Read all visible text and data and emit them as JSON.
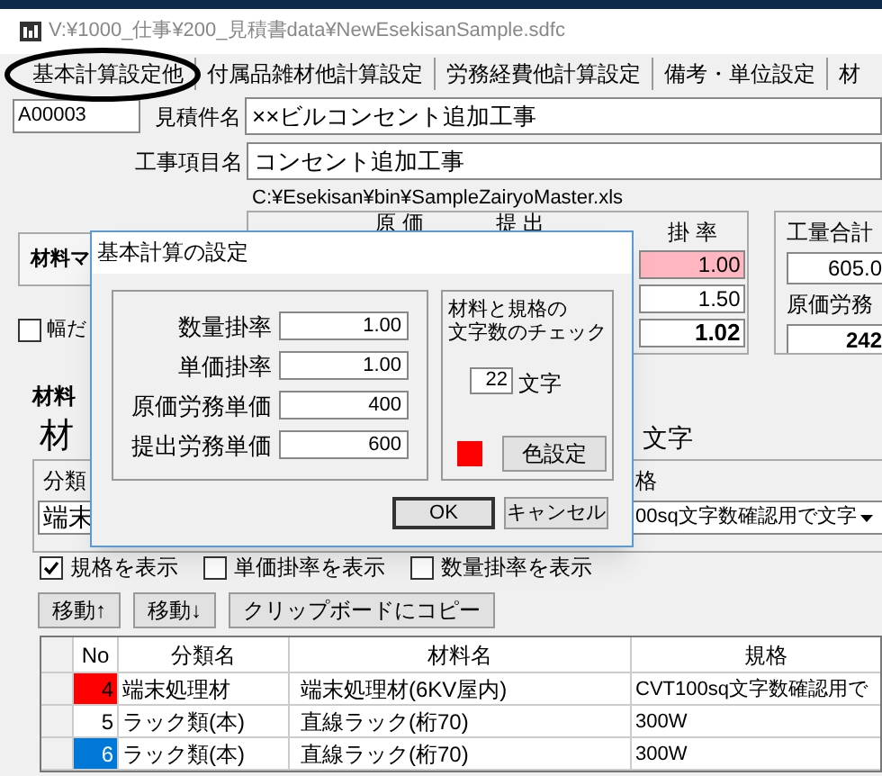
{
  "window": {
    "title": "V:¥1000_仕事¥200_見積書data¥NewEsekisanSample.sdfc"
  },
  "menu": [
    {
      "label": "基本計算設定他",
      "circled": true
    },
    {
      "label": "付属品雑材他計算設定",
      "circled": false
    },
    {
      "label": "労務経費他計算設定",
      "circled": false
    },
    {
      "label": "備考・単位設定",
      "circled": false
    },
    {
      "label": "材",
      "circled": false
    }
  ],
  "header": {
    "code": "A00003",
    "estimate_label": "見積件名",
    "estimate_name": "××ビルコンセント追加工事",
    "item_label": "工事項目名",
    "item_name": "コンセント追加工事",
    "master_path": "C:¥Esekisan¥bin¥SampleZairyoMaster.xls"
  },
  "panel_button": "材料マ",
  "width_check": {
    "label": "幅だ",
    "checked": false
  },
  "summary": {
    "columns": [
      "原 価",
      "提 出",
      "掛 率"
    ],
    "rates": [
      {
        "value": "1.00",
        "kind": "highlight"
      },
      {
        "value": "1.50",
        "kind": "plain"
      },
      {
        "value": "1.02",
        "kind": "total"
      }
    ]
  },
  "totals": {
    "label": "工量合計",
    "value": "605.0",
    "label_2": "原価労務",
    "value_2": "242"
  },
  "material_tab": "材料",
  "material_heading": "材",
  "chars_suffix": "文字",
  "group": {
    "label": "分類",
    "label_2": "格",
    "combo": "端末",
    "dropdown": "00sq文字数確認用で文字"
  },
  "options": [
    {
      "label": "規格を表示",
      "checked": true
    },
    {
      "label": "単価掛率を表示",
      "checked": false
    },
    {
      "label": "数量掛率を表示",
      "checked": false
    }
  ],
  "buttons": [
    "移動↑",
    "移動↓",
    "クリップボードにコピー"
  ],
  "table": {
    "columns": [
      "No",
      "分類名",
      "材料名",
      "規格"
    ],
    "rows": [
      {
        "no": "4",
        "color": "#ff0000",
        "category": "端末処理材",
        "name": "端末処理材(6KV屋内)",
        "spec": "CVT100sq文字数確認用で"
      },
      {
        "no": "5",
        "color": "#ffffff",
        "category": "ラック類(本)",
        "name": "直線ラック(桁70)",
        "spec": "300W"
      },
      {
        "no": "6",
        "color": "#0078d7",
        "category": "ラック類(本)",
        "name": "直線ラック(桁70)",
        "spec": "300W"
      }
    ]
  },
  "dialog": {
    "title": "基本計算の設定",
    "fields": [
      {
        "label": "数量掛率",
        "value": "1.00"
      },
      {
        "label": "単価掛率",
        "value": "1.00"
      },
      {
        "label": "原価労務単価",
        "value": "400"
      },
      {
        "label": "提出労務単価",
        "value": "600"
      }
    ],
    "check_lines": [
      "材料と規格の",
      "文字数のチェック"
    ],
    "char_count": "22",
    "char_unit": "文字",
    "swatch": {
      "color": "#ff0000"
    },
    "color_button": "色設定",
    "ok": "OK",
    "cancel": "キャンセル"
  }
}
